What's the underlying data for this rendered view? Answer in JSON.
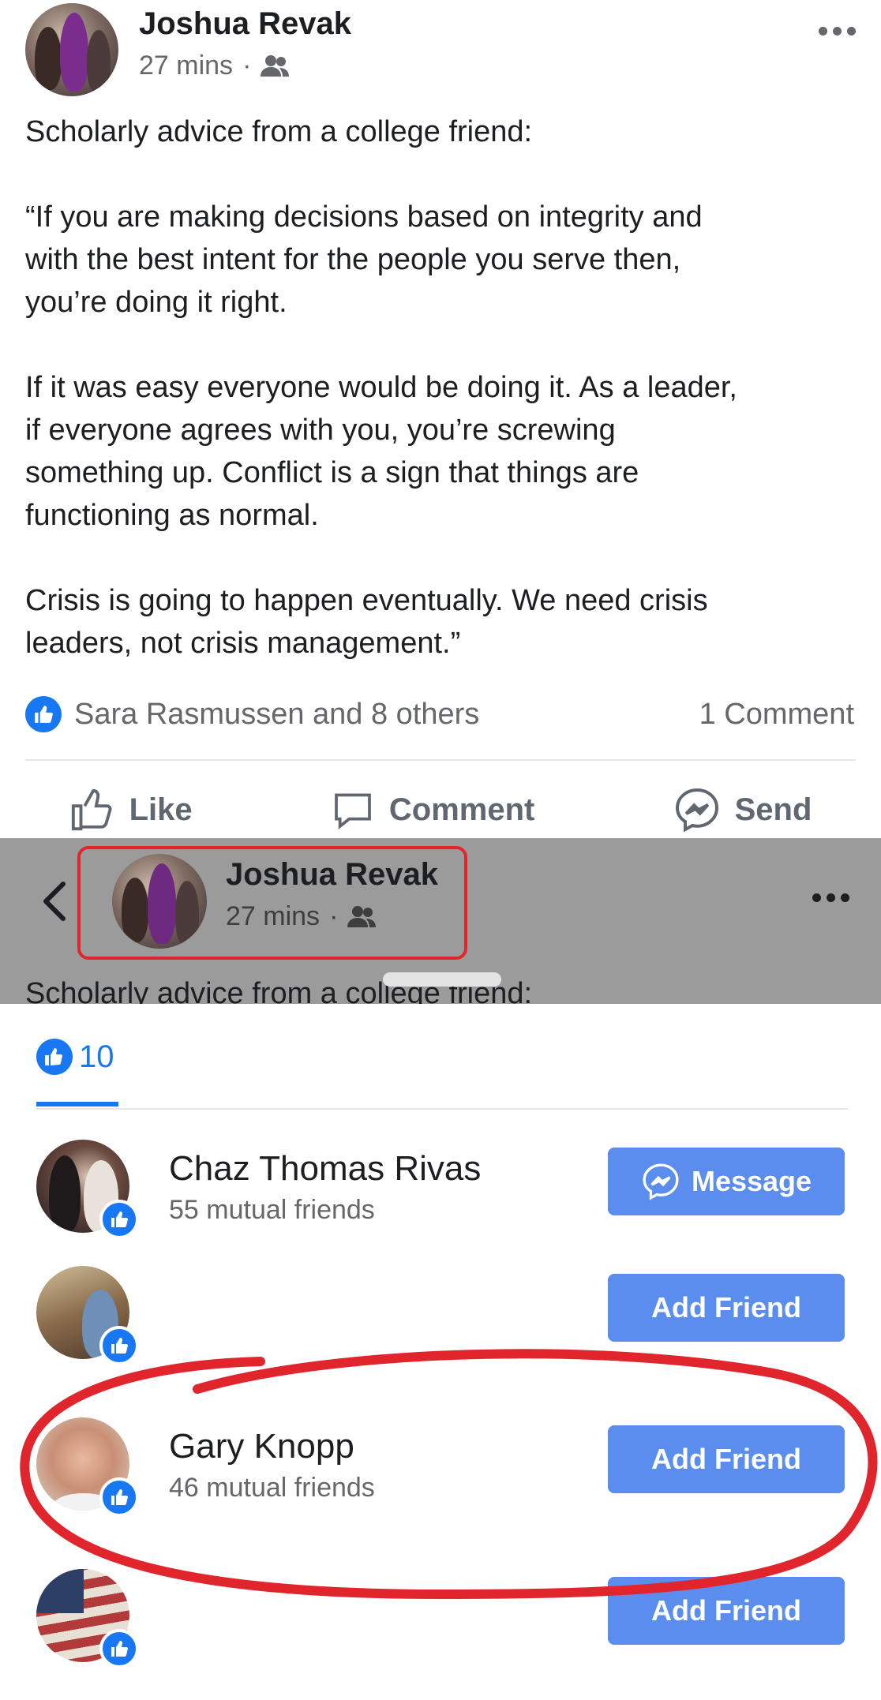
{
  "post": {
    "author": "Joshua Revak",
    "time": "27 mins",
    "audience_icon": "friends-icon",
    "paragraphs": [
      "Scholarly advice from a college friend:",
      "“If you are making decisions based on integrity and\nwith the best intent for the people you serve then,\nyou’re doing it right.",
      "If it was easy everyone would be doing it. As a leader,\nif everyone agrees with you, you’re screwing\nsomething up.  Conflict is a sign that things are\nfunctioning as normal.",
      "Crisis is going to happen eventually. We need crisis\nleaders, not crisis management.”"
    ],
    "reactions_text": "Sara Rasmussen and 8 others",
    "comments_text": "1 Comment",
    "actions": {
      "like": "Like",
      "comment": "Comment",
      "send": "Send"
    }
  },
  "sheet_header": {
    "author": "Joshua Revak",
    "time": "27 mins",
    "peek_text": "Scholarly advice from a college friend:"
  },
  "reactions_sheet": {
    "tab_count": "10",
    "people": [
      {
        "name": "Chaz Thomas Rivas",
        "mutual": "55 mutual friends",
        "button": "Message",
        "button_icon": "messenger-icon"
      },
      {
        "name": "",
        "mutual": "",
        "button": "Add Friend"
      },
      {
        "name": "Gary Knopp",
        "mutual": "46 mutual friends",
        "button": "Add Friend"
      },
      {
        "name": "",
        "mutual": "",
        "button": "Add Friend"
      }
    ]
  },
  "colors": {
    "accent": "#1877f2",
    "button": "#5b8def",
    "dim_overlay": "#9b9b9b",
    "annotation": "#e0252c"
  }
}
